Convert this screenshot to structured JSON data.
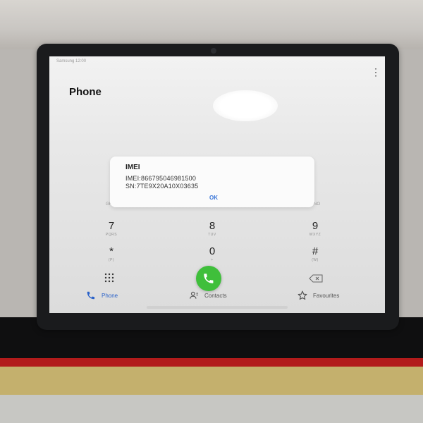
{
  "screen": {
    "status_left": "Samsung 12:00",
    "status_right": "",
    "app_title": "Phone",
    "more_label": "⋮"
  },
  "dialog": {
    "title": "IMEI",
    "imei_line": "IMEI:866795046981500",
    "sn_line": "SN:7TE9X20A10X03635",
    "ok_label": "OK"
  },
  "partial_keys": {
    "left": "GHI",
    "right": "MNO"
  },
  "keypad": [
    {
      "num": "7",
      "letters": "PQRS"
    },
    {
      "num": "8",
      "letters": "TUV"
    },
    {
      "num": "9",
      "letters": "WXYZ"
    },
    {
      "num": "*",
      "letters": "(P)"
    },
    {
      "num": "0",
      "letters": "+"
    },
    {
      "num": "#",
      "letters": "(W)"
    }
  ],
  "bottom_nav": {
    "phone": "Phone",
    "contacts": "Contacts",
    "favourites": "Favourites"
  },
  "colors": {
    "accent": "#2a62c9",
    "call_green": "#3fbf3b",
    "ok_blue": "#3a76d8"
  }
}
